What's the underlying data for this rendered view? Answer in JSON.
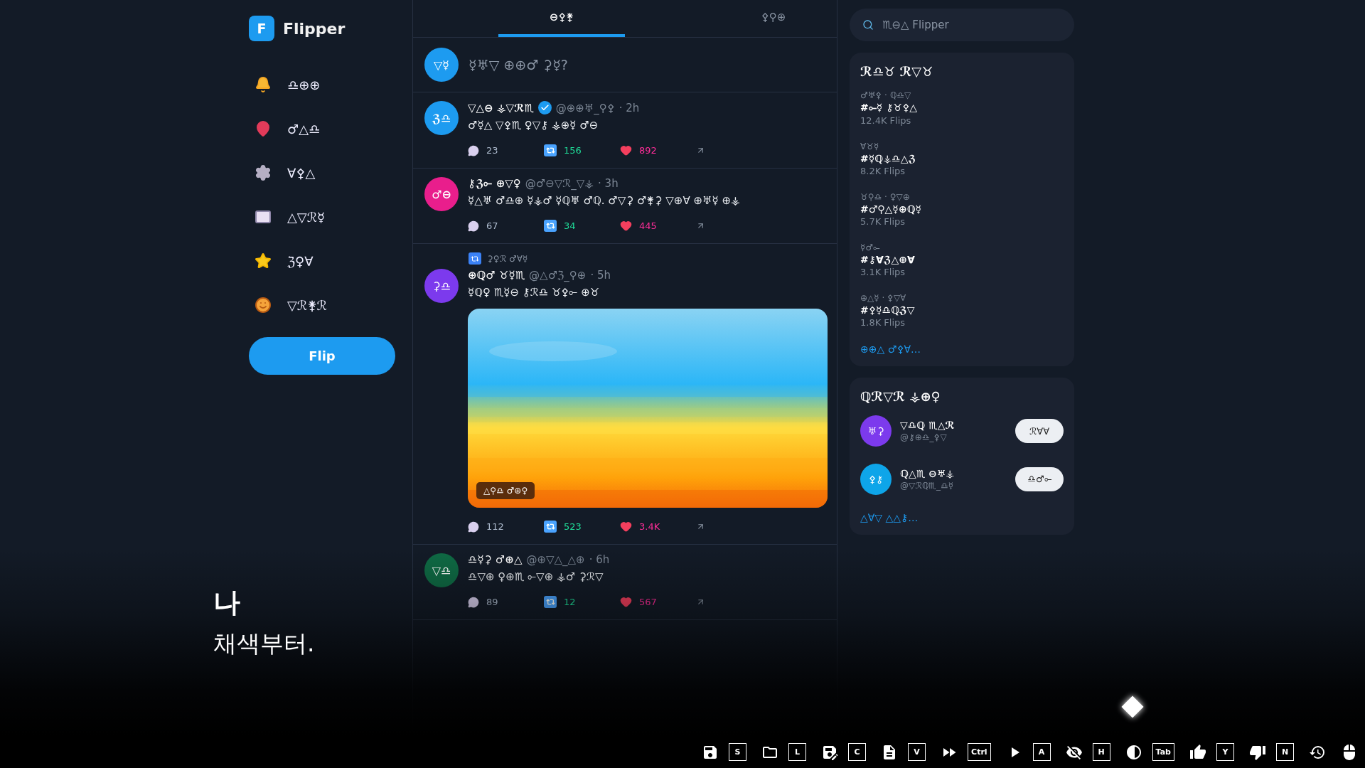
{
  "app": {
    "logo_letter": "F",
    "name": "Flipper"
  },
  "nav": [
    {
      "kind": "bell",
      "label": "♎⊕⊕"
    },
    {
      "kind": "pin",
      "label": "♂△♎"
    },
    {
      "kind": "gear",
      "label": "∀⚴△"
    },
    {
      "kind": "mail",
      "label": "△▽ℛ☿"
    },
    {
      "kind": "star",
      "label": "ℨ♀∀"
    },
    {
      "kind": "person",
      "label": "▽ℛ⚵ℛ"
    }
  ],
  "flip_button": "Flip",
  "tabs": [
    {
      "label": "⊖⚴⚵",
      "selected": true
    },
    {
      "label": "⚴⚲⊕",
      "selected": false
    }
  ],
  "composer": {
    "avatar": "▽☿",
    "color": "#1d9bf0",
    "placeholder": "☿♅▽ ⊕⊕♂ ⚳☿?"
  },
  "posts": [
    {
      "avatar": "ℨ♎",
      "color": "#1d9bf0",
      "name": "▽△⊖ ⚶▽ℛ♏",
      "verified": true,
      "handle": "@⊕⊕♅_⚲⚴",
      "time": "· 2h",
      "text": "♂☿△ ▽⚴♏ ♀▽⚷ ⚶⊕☿ ♂⊖",
      "replies": "23",
      "reposts": "156",
      "likes": "892"
    },
    {
      "avatar": "♂⊖",
      "color": "#e91e8c",
      "name": "⚷ℨ⟜ ⊕▽♀",
      "verified": false,
      "handle": "@♂⊖▽ℛ_▽⚶",
      "time": "· 3h",
      "text": "☿△♅ ♂♎⊕ ☿⚶♂ ☿ℚ♅ ♂ℚ. ♂▽⚳ ♂⚵⚳ ▽⊕∀ ⊕♅☿ ⊕⚶",
      "replies": "67",
      "reposts": "34",
      "likes": "445"
    },
    {
      "repost_by": "⚳♀ℛ ♂∀☿",
      "avatar": "⚳♎",
      "color": "#7c3aed",
      "name": "⊕ℚ♂ ♉☿♏",
      "verified": false,
      "handle": "@△♂ℨ_⚲⊕",
      "time": "· 5h",
      "text": "☿ℚ♀ ♏☿⊖ ⚷ℛ♎ ♉⚴⟜ ⊕♉",
      "image": {
        "kind": "picture",
        "tag": "△⚲♎ ♂⊕♀"
      },
      "replies": "112",
      "reposts": "523",
      "likes": "3.4K"
    },
    {
      "avatar": "▽♎",
      "color": "#0f6b45",
      "name": "♎☿⚳ ♂⊕△",
      "verified": false,
      "handle": "@⊕▽△_△⊕",
      "time": "· 6h",
      "text": "♎▽⊕ ♀⊕♏ ⟜▽⊕ ⚶♂ ⚳ℛ▽",
      "replies": "89",
      "reposts": "12",
      "likes": "567"
    }
  ],
  "search": {
    "placeholder": "♏⊖△ Flipper"
  },
  "trends": {
    "title": "ℛ♎♉ ℛ▽♉",
    "items": [
      {
        "category": "♂♅⚴ · ℚ♎▽",
        "tag": "#⟜☿ ⚷♉⚴△",
        "count": "12.4K Flips"
      },
      {
        "category": "∀♉☿",
        "tag": "#☿ℚ⚶♎△ℨ",
        "count": "8.2K Flips"
      },
      {
        "category": "♉⚲♎ · ♀▽⊕",
        "tag": "#♂⚲△☿⊕ℚ☿",
        "count": "5.7K Flips"
      },
      {
        "category": "☿♂⟜",
        "tag": "#⚷∀ℨ△⊕∀",
        "count": "3.1K Flips"
      },
      {
        "category": "⊕△☿ · ⚴▽∀",
        "tag": "#⚴☿♎ℚℨ▽",
        "count": "1.8K Flips"
      }
    ],
    "show_more": "⊕⊕△ ♂⚴∀…"
  },
  "follow": {
    "title": "ℚℛ▽ℛ ⚶⊕♀",
    "users": [
      {
        "avatar": "♅⚳",
        "color": "#7c3aed",
        "name": "▽♎ℚ ♏△ℛ",
        "handle": "@⚷⊕♎_⚴▽",
        "button": "ℛ∀∀"
      },
      {
        "avatar": "⚴⚷",
        "color": "#0ea5e9",
        "name": "ℚ△♏ ⊖♅⚶",
        "handle": "@▽ℛℚ♏_♎☿",
        "button": "♎♂⟜"
      }
    ],
    "show_more": "△∀▽ △△⚷…"
  },
  "dialogue": {
    "speaker": "나",
    "line": "채색부터."
  },
  "quick_menu": [
    {
      "kind": "save",
      "key": "S"
    },
    {
      "kind": "load",
      "key": "L"
    },
    {
      "kind": "quicksave",
      "key": "C"
    },
    {
      "kind": "log",
      "key": "V"
    },
    {
      "kind": "skip",
      "key": "Ctrl"
    },
    {
      "kind": "auto",
      "key": "A"
    },
    {
      "kind": "hide",
      "key": "H"
    },
    {
      "kind": "contrast",
      "key": "Tab"
    },
    {
      "kind": "yes",
      "key": "Y"
    },
    {
      "kind": "no",
      "key": "N"
    },
    {
      "kind": "history"
    },
    {
      "kind": "mouse"
    }
  ]
}
